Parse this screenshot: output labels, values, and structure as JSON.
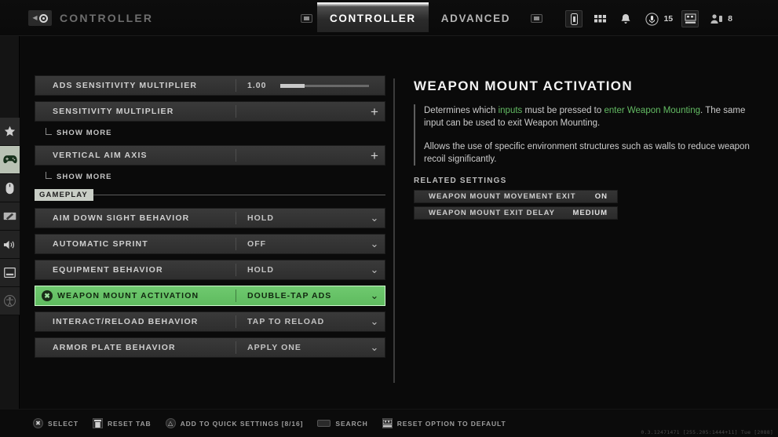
{
  "header": {
    "breadcrumb_icon": "back-circle-icon",
    "breadcrumb_title": "CONTROLLER",
    "tabs": [
      {
        "label": "CONTROLLER",
        "active": true
      },
      {
        "label": "ADVANCED",
        "active": false
      }
    ],
    "tab_hint_left": "lb-bumper-icon",
    "tab_hint_right": "rb-bumper-icon",
    "system_icons": [
      {
        "name": "battery-icon",
        "value": ""
      },
      {
        "name": "apps-grid-icon",
        "value": ""
      },
      {
        "name": "bell-icon",
        "value": ""
      },
      {
        "name": "microphone-icon",
        "value": "15"
      },
      {
        "name": "party-social-icon",
        "value": ""
      },
      {
        "name": "friends-icon",
        "value": "8"
      }
    ]
  },
  "sidebar": {
    "items": [
      {
        "name": "favorites",
        "icon": "star-icon",
        "active": false
      },
      {
        "name": "controller",
        "icon": "gamepad-icon",
        "active": true
      },
      {
        "name": "mouse-keyboard",
        "icon": "mouse-icon",
        "active": false
      },
      {
        "name": "graphics",
        "icon": "display-pen-icon",
        "active": false
      },
      {
        "name": "audio",
        "icon": "speaker-icon",
        "active": false
      },
      {
        "name": "interface",
        "icon": "window-icon",
        "active": false
      },
      {
        "name": "accessibility",
        "icon": "accessibility-icon",
        "active": false
      }
    ]
  },
  "settings": {
    "slider_row": {
      "label": "ADS SENSITIVITY MULTIPLIER",
      "value": "1.00",
      "fill_percent": 27
    },
    "expandable": [
      {
        "label": "SENSITIVITY MULTIPLIER",
        "control": "+",
        "sub_label": "SHOW MORE"
      },
      {
        "label": "VERTICAL AIM AXIS",
        "control": "+",
        "sub_label": "SHOW MORE"
      }
    ],
    "section": "GAMEPLAY",
    "rows": [
      {
        "label": "AIM DOWN SIGHT BEHAVIOR",
        "value": "HOLD",
        "selected": false,
        "quick": false
      },
      {
        "label": "AUTOMATIC SPRINT",
        "value": "OFF",
        "selected": false,
        "quick": false
      },
      {
        "label": "EQUIPMENT BEHAVIOR",
        "value": "HOLD",
        "selected": false,
        "quick": false
      },
      {
        "label": "WEAPON MOUNT ACTIVATION",
        "value": "DOUBLE-TAP ADS",
        "selected": true,
        "quick": true
      },
      {
        "label": "INTERACT/RELOAD BEHAVIOR",
        "value": "TAP TO RELOAD",
        "selected": false,
        "quick": false
      },
      {
        "label": "ARMOR PLATE BEHAVIOR",
        "value": "APPLY ONE",
        "selected": false,
        "quick": false
      }
    ]
  },
  "detail": {
    "title": "WEAPON MOUNT ACTIVATION",
    "paragraph1": {
      "part1": "Determines which ",
      "hl1": "inputs",
      "part2": " must be pressed to ",
      "hl2": "enter Weapon Mounting",
      "part3": ". The same input can be used to exit Weapon Mounting."
    },
    "paragraph2": "Allows the use of specific environment structures such as walls to reduce weapon recoil significantly.",
    "related_heading": "RELATED SETTINGS",
    "related": [
      {
        "name": "WEAPON MOUNT MOVEMENT EXIT",
        "value": "ON"
      },
      {
        "name": "WEAPON MOUNT EXIT DELAY",
        "value": "MEDIUM"
      }
    ]
  },
  "footer": {
    "hints": [
      {
        "glyph": "a-button-icon",
        "label": "SELECT"
      },
      {
        "glyph": "x-button-icon",
        "label": "RESET TAB"
      },
      {
        "glyph": "y-button-icon",
        "label": "ADD TO QUICK SETTINGS [8/16]"
      },
      {
        "glyph": "keyboard-key-icon",
        "label": "SEARCH"
      },
      {
        "glyph": "dpad-icon",
        "label": "RESET OPTION TO DEFAULT"
      }
    ],
    "build": "0.3.12471471 [255.205:1444+11] Tue [2088]"
  },
  "colors": {
    "accent_green": "#6fc96f",
    "panel_bg": "#2e2e2e",
    "text": "#cfcfcf"
  }
}
